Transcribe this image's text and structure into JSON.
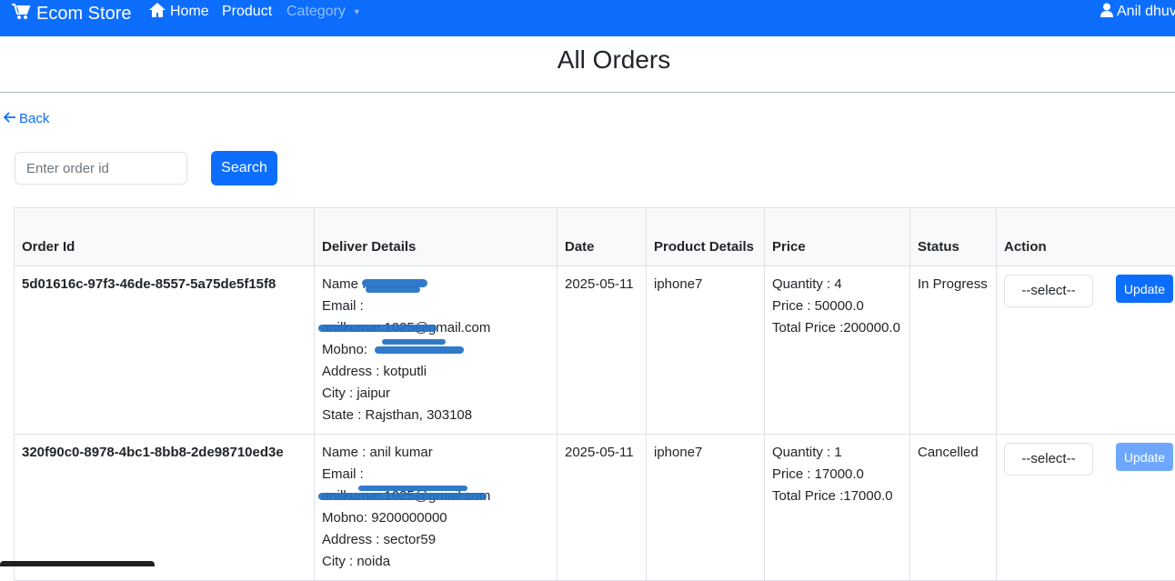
{
  "nav": {
    "brand": "Ecom Store",
    "home": "Home",
    "product": "Product",
    "category": "Category",
    "user": "Anil dhuv"
  },
  "page": {
    "title": "All Orders",
    "back": "Back"
  },
  "search": {
    "placeholder": "Enter order id",
    "button": "Search"
  },
  "table": {
    "headers": {
      "order_id": "Order Id",
      "deliver": "Deliver Details",
      "date": "Date",
      "product": "Product Details",
      "price": "Price",
      "status": "Status",
      "action": "Action"
    },
    "rows": [
      {
        "order_id": "5d01616c-97f3-46de-8557-5a75de5f15f8",
        "name": "Name :",
        "email_label": "Email :",
        "email": "anilkumar.1025@gmail.com",
        "mobno": "Mobno:",
        "address": "Address : kotputli",
        "city": "City : jaipur",
        "state": "State : Rajsthan, 303108",
        "date": "2025-05-11",
        "product": "iphone7",
        "quantity": "Quantity : 4",
        "price": "Price : 50000.0",
        "total": "Total Price :200000.0",
        "status": "In Progress",
        "select": "--select--",
        "update": "Update"
      },
      {
        "order_id": "320f90c0-8978-4bc1-8bb8-2de98710ed3e",
        "name": "Name : anil kumar",
        "email_label": "Email :",
        "email": "anilkumar.1025@gmail.com",
        "mobno": "Mobno: 9200000000",
        "address": "Address : sector59",
        "city": "City : noida",
        "state": "",
        "date": "2025-05-11",
        "product": "iphone7",
        "quantity": "Quantity : 1",
        "price": "Price : 17000.0",
        "total": "Total Price :17000.0",
        "status": "Cancelled",
        "select": "--select--",
        "update": "Update"
      }
    ]
  }
}
